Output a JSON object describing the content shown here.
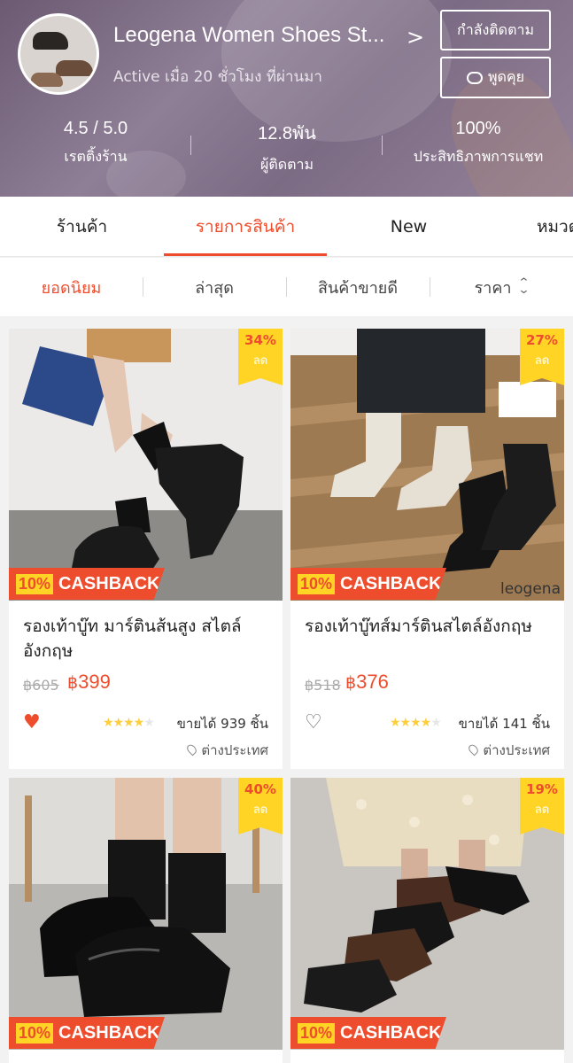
{
  "shop": {
    "name": "Leogena Women Shoes St...",
    "active_status": "Active เมื่อ 20 ชั่วโมง ที่ผ่านมา",
    "follow_button": "กำลังติดตาม",
    "chat_button": "พูดคุย",
    "stats": [
      {
        "value": "4.5 / 5.0",
        "label": "เรตติ้งร้าน"
      },
      {
        "value": "12.8พัน",
        "label": "ผู้ติดตาม"
      },
      {
        "value": "100%",
        "label": "ประสิทธิภาพการแชท"
      }
    ]
  },
  "tabs": [
    {
      "label": "ร้านค้า",
      "active": false
    },
    {
      "label": "รายการสินค้า",
      "active": true
    },
    {
      "label": "New",
      "active": false
    },
    {
      "label": "หมวดหมู่",
      "active": false
    }
  ],
  "sort": [
    {
      "label": "ยอดนิยม",
      "active": true
    },
    {
      "label": "ล่าสุด",
      "active": false
    },
    {
      "label": "สินค้าขายดี",
      "active": false
    },
    {
      "label": "ราคา",
      "active": false
    }
  ],
  "cashback": {
    "percent": "10%",
    "text": "CASHBACK"
  },
  "discount_label": "ลด",
  "products": [
    {
      "discount": "34%",
      "title": "รองเท้าบู๊ท มาร์ตินส้นสูง สไตล์อังกฤษ",
      "old_price": "฿605",
      "currency": "฿",
      "price": "399",
      "rating": 4.5,
      "sold": "ขายได้ 939 ชิ้น",
      "location": "ต่างประเทศ",
      "liked": true
    },
    {
      "discount": "27%",
      "title": "รองเท้าบู๊ทส์มาร์ตินสไตล์อังกฤษ",
      "old_price": "฿518",
      "currency": "฿",
      "price": "376",
      "rating": 4.5,
      "sold": "ขายได้ 141 ชิ้น",
      "location": "ต่างประเทศ",
      "liked": false,
      "watermark": "leogena"
    },
    {
      "discount": "40%"
    },
    {
      "discount": "19%"
    }
  ],
  "colors": {
    "accent": "#ee4d2d",
    "badge": "#ffd424",
    "star": "#ffce3d"
  },
  "icons": [
    "chevron-right-icon",
    "chat-icon",
    "sort-arrows-icon",
    "heart-icon",
    "star-icon",
    "location-pin-icon"
  ]
}
